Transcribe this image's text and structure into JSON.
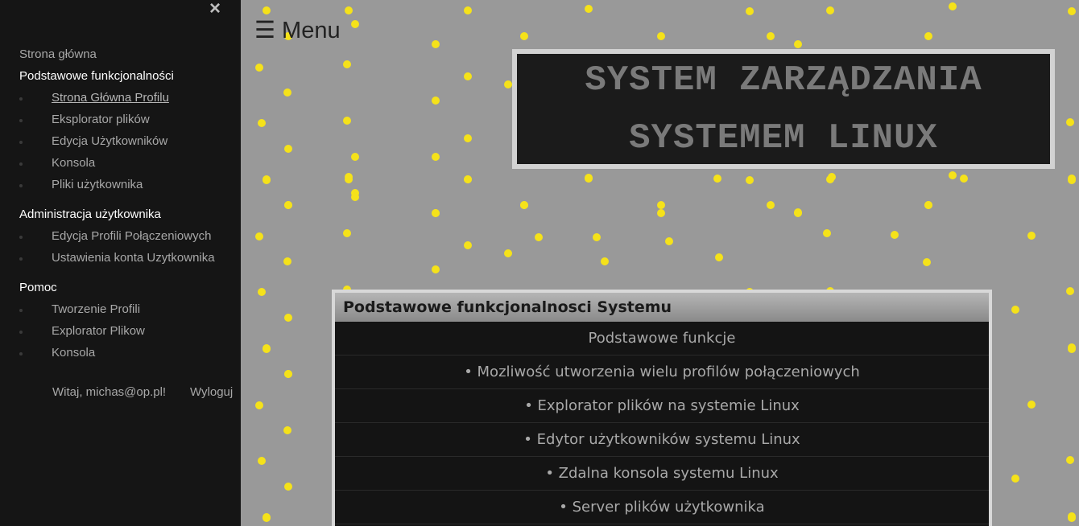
{
  "sidebar": {
    "close_icon": "×",
    "home": "Strona główna",
    "groups": [
      {
        "title": "Podstawowe funkcjonalności",
        "items": [
          "Strona Główna Profilu",
          "Eksplorator plików",
          "Edycja Użytkowników",
          "Konsola",
          "Pliki użytkownika"
        ]
      },
      {
        "title": "Administracja użytkownika",
        "items": [
          "Edycja Profili Połączeniowych",
          "Ustawienia konta Uzytkownika"
        ]
      },
      {
        "title": "Pomoc",
        "items": [
          "Tworzenie Profili",
          "Explorator Plikow",
          "Konsola"
        ]
      }
    ],
    "welcome": "Witaj, michas@op.pl!",
    "logout": "Wyloguj"
  },
  "main": {
    "menu_label": "☰ Menu",
    "title_line1": "SYSTEM ZARZĄDZANIA",
    "title_line2": "SYSTEMEM LINUX",
    "features": {
      "header": "Podstawowe funkcjonalnosci Systemu",
      "rows": [
        "Podstawowe funkcje",
        "• Mozliwość utworzenia wielu profilów połączeniowych",
        "• Explorator plików na systemie Linux",
        "• Edytor użytkowników systemu Linux",
        "• Zdalna konsola systemu Linux",
        "• Server plików użytkownika"
      ]
    }
  },
  "colors": {
    "sidebar_bg": "#151515",
    "page_bg": "#999999",
    "star": "#f5e21a"
  }
}
